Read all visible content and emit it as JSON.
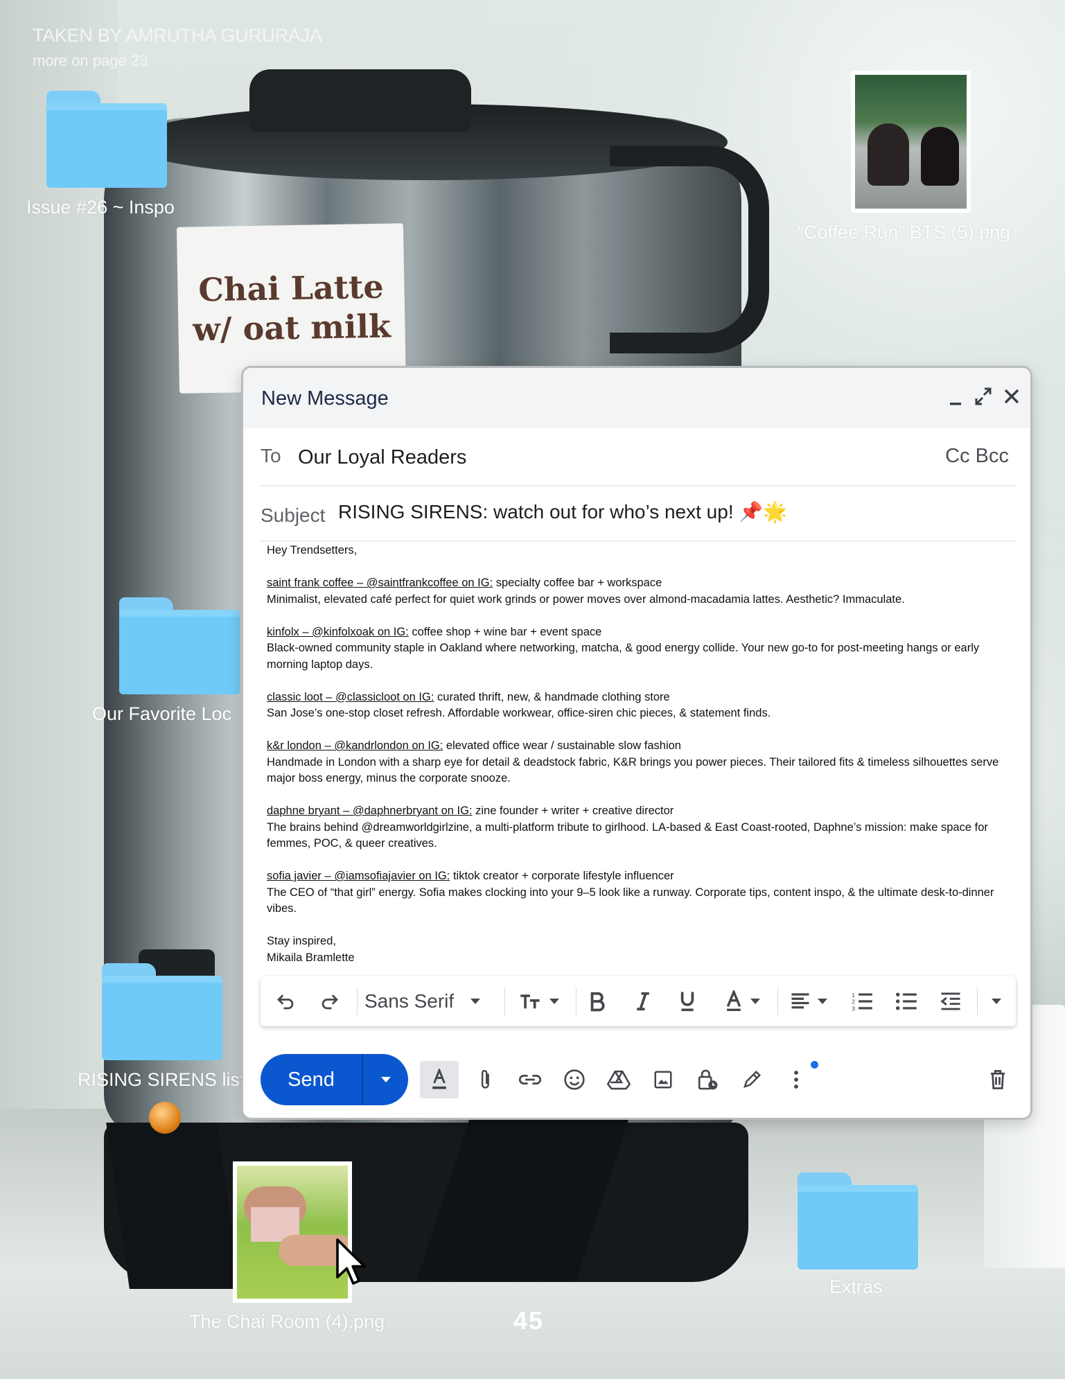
{
  "header": {
    "credit": "TAKEN BY AMRUTHA GURURAJA",
    "credit_sub": "more on page 23"
  },
  "photo": {
    "sticker_line1": "Chai Latte",
    "sticker_line2": "w/ oat milk"
  },
  "desktop": {
    "folders": [
      {
        "label": "Issue #26 ~ Inspo"
      },
      {
        "label": "Our Favorite Loc"
      },
      {
        "label": "RISING SIRENS list"
      },
      {
        "label": "Extras"
      }
    ],
    "files": [
      {
        "label": "“Coffee Run” BTS (5).png"
      },
      {
        "label": "The Chai Room (4).png"
      }
    ]
  },
  "page_number": "45",
  "compose": {
    "title": "New Message",
    "to_label": "To",
    "to_value": "Our Loyal Readers",
    "cc_bcc": "Cc Bcc",
    "subject_label": "Subject",
    "subject_value": "RISING SIRENS: watch out for who’s next up! 📌🌟",
    "greeting": "Hey Trendsetters,",
    "entries": [
      {
        "handle": "saint frank coffee – @saintfrankcoffee on IG:",
        "tagline": " specialty coffee bar + workspace",
        "description": "Minimalist, elevated café perfect for quiet work grinds or power moves over almond-macadamia lattes. Aesthetic? Immaculate."
      },
      {
        "handle": "kinfolx – @kinfolxoak on IG:",
        "tagline": " coffee shop + wine bar + event space",
        "description": "Black-owned community staple in Oakland where networking, matcha, & good energy collide. Your new go-to for post-meeting hangs or early morning laptop days."
      },
      {
        "handle": "classic loot – @classicloot on IG:",
        "tagline": " curated thrift, new, & handmade clothing store",
        "description": "San Jose’s one-stop closet refresh. Affordable workwear, office-siren chic pieces, & statement finds."
      },
      {
        "handle": "k&r london – @kandrlondon on IG:",
        "tagline": " elevated office wear / sustainable slow fashion",
        "description": "Handmade in London with a sharp eye for detail & deadstock fabric, K&R brings you power pieces. Their tailored fits & timeless silhouettes serve major boss energy, minus the corporate snooze."
      },
      {
        "handle": "daphne bryant – @daphnerbryant on IG:",
        "tagline": " zine founder + writer + creative director",
        "description": "The brains behind @dreamworldgirlzine, a multi-platform tribute to girlhood. LA-based & East Coast-rooted, Daphne’s mission: make space for femmes, POC, & queer creatives."
      },
      {
        "handle": "sofia javier – @iamsofiajavier on IG:",
        "tagline": " tiktok creator + corporate lifestyle influencer",
        "description": "The CEO of “that girl” energy. Sofia makes clocking into your 9–5 look like a runway. Corporate tips, content inspo, & the ultimate desk-to-dinner vibes."
      }
    ],
    "signoff": "Stay inspired,",
    "signature": "Mikaila Bramlette",
    "toolbar": {
      "font": "Sans Serif"
    },
    "send_label": "Send"
  },
  "colors": {
    "send_blue": "#0b57d0",
    "folder_blue": "#6fcaf7",
    "title_navy": "#1d2a44"
  }
}
